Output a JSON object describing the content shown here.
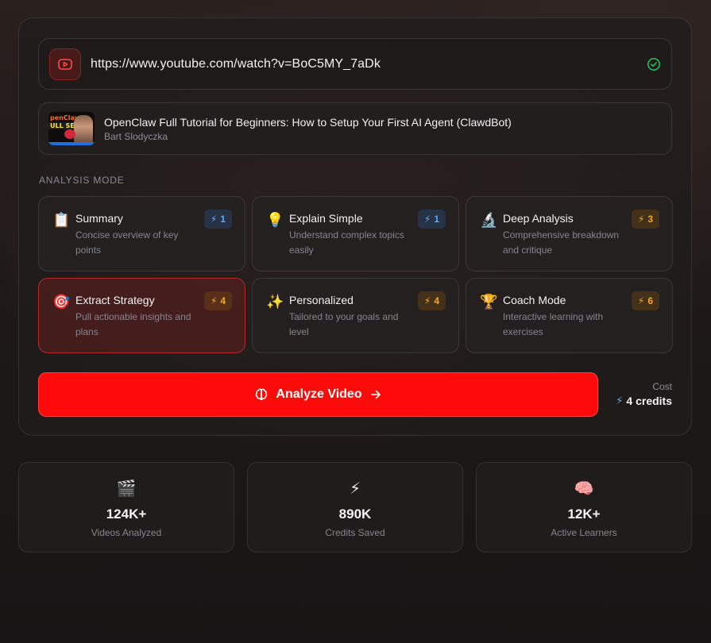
{
  "url_bar": {
    "value": "https://www.youtube.com/watch?v=BoC5MY_7aDk",
    "icon": "youtube-icon",
    "status_icon": "check-circle-icon"
  },
  "video": {
    "title": "OpenClaw Full Tutorial for Beginners: How to Setup Your First AI Agent (ClawdBot)",
    "author": "Bart Slodyczka",
    "thumbnail_text_1": "penClaw",
    "thumbnail_text_2": "ULL SETUP"
  },
  "analysis_mode_label": "ANALYSIS MODE",
  "modes": [
    {
      "emoji": "📋",
      "title": "Summary",
      "desc": "Concise overview of key points",
      "cost": "1",
      "badge_color": "blue"
    },
    {
      "emoji": "💡",
      "title": "Explain Simple",
      "desc": "Understand complex topics easily",
      "cost": "1",
      "badge_color": "blue"
    },
    {
      "emoji": "🔬",
      "title": "Deep Analysis",
      "desc": "Comprehensive breakdown and critique",
      "cost": "3",
      "badge_color": "amber"
    },
    {
      "emoji": "🎯",
      "title": "Extract Strategy",
      "desc": "Pull actionable insights and plans",
      "cost": "4",
      "badge_color": "amber",
      "selected": true
    },
    {
      "emoji": "✨",
      "title": "Personalized",
      "desc": "Tailored to your goals and level",
      "cost": "4",
      "badge_color": "amber"
    },
    {
      "emoji": "🏆",
      "title": "Coach Mode",
      "desc": "Interactive learning with exercises",
      "cost": "6",
      "badge_color": "amber"
    }
  ],
  "analyze_button": {
    "label": "Analyze Video",
    "icon": "brain-icon",
    "arrow_icon": "arrow-right-icon",
    "color": "#ff0a0a"
  },
  "cost": {
    "label": "Cost",
    "value": "4 credits"
  },
  "stats": [
    {
      "emoji": "🎬",
      "value": "124K+",
      "label": "Videos Analyzed"
    },
    {
      "emoji": "⚡",
      "value": "890K",
      "label": "Credits Saved"
    },
    {
      "emoji": "🧠",
      "value": "12K+",
      "label": "Active Learners"
    }
  ],
  "colors": {
    "accent_red": "#ff0a0a",
    "credit_blue": "#5fa8ff",
    "credit_amber": "#f3a826",
    "check_green": "#22c55e"
  }
}
